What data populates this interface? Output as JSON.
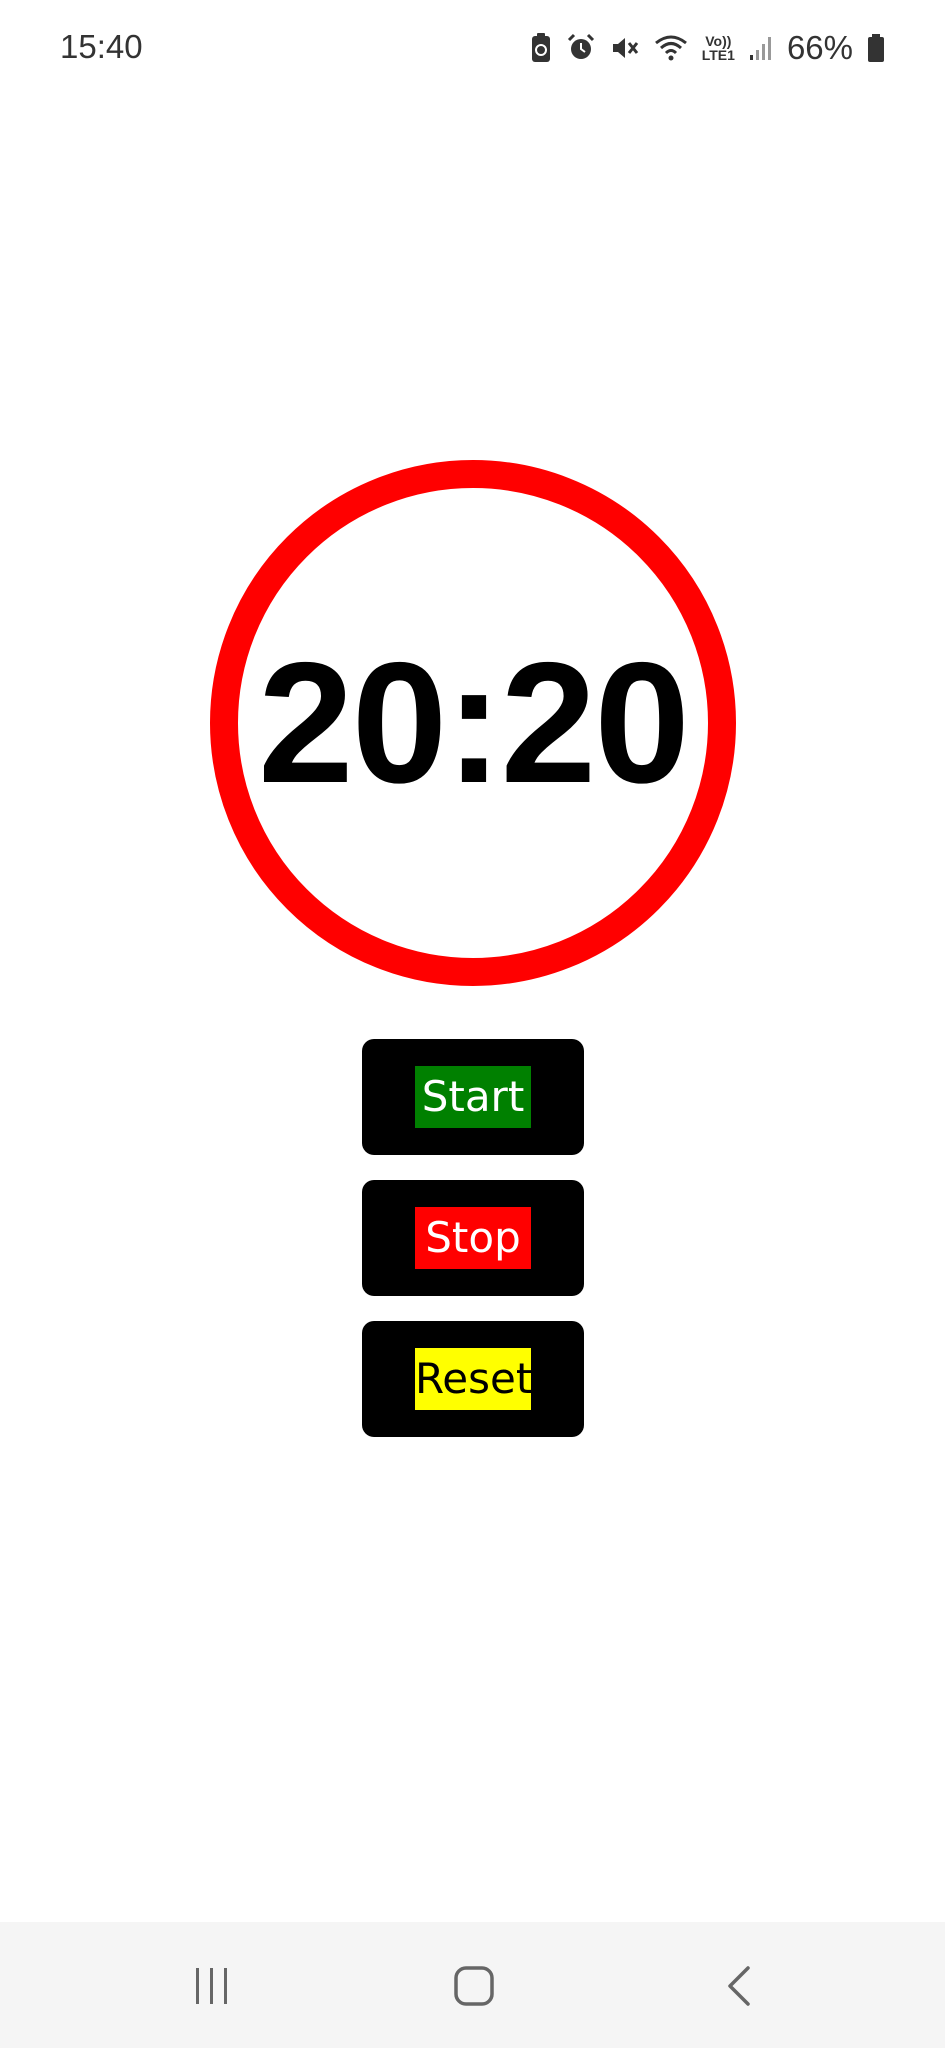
{
  "status_bar": {
    "time": "15:40",
    "icons": [
      "battery-saver-icon",
      "alarm-icon",
      "mute-icon",
      "wifi-icon",
      "volte-lte-icon",
      "signal-icon",
      "battery-icon"
    ],
    "volte_label": "Vo))",
    "lte_label": "LTE1",
    "battery_percent": "66%"
  },
  "timer": {
    "display": "20:20",
    "ring_color": "#ff0000"
  },
  "buttons": {
    "start": {
      "label": "Start",
      "color": "#008000"
    },
    "stop": {
      "label": "Stop",
      "color": "#ff0000"
    },
    "reset": {
      "label": "Reset",
      "color": "#ffff00"
    }
  },
  "nav_bar": {
    "icons": [
      "recents-icon",
      "home-icon",
      "back-icon"
    ]
  }
}
